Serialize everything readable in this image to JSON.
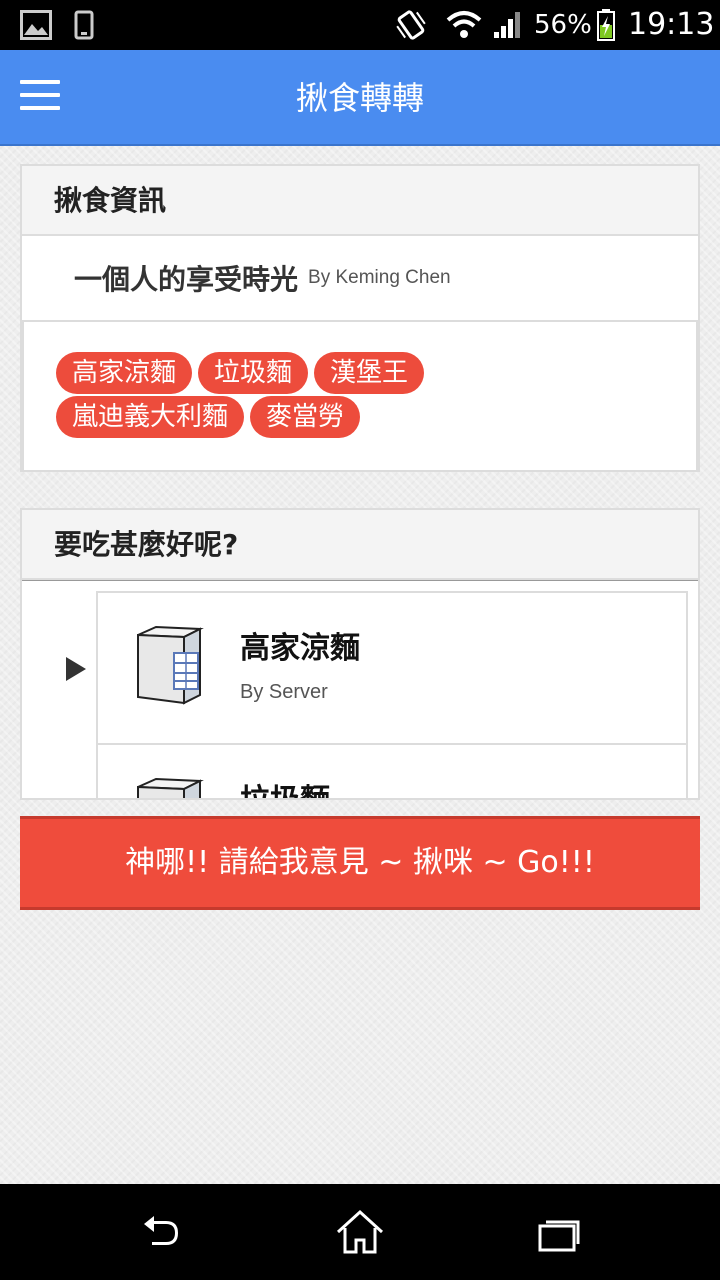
{
  "status_bar": {
    "battery_percent": "56%",
    "time": "19:13",
    "icons": [
      "image-icon",
      "phone-icon",
      "vibrate-icon",
      "wifi-icon",
      "signal-icon",
      "battery-charging-icon"
    ]
  },
  "app_bar": {
    "title": "揪食轉轉",
    "menu_icon": "hamburger-menu-icon"
  },
  "news_card": {
    "header": "揪食資訊",
    "item_title": "一個人的享受時光",
    "item_author": "By Keming Chen",
    "tags": [
      "高家涼麵",
      "垃圾麵",
      "漢堡王",
      "嵐迪義大利麵",
      "麥當勞"
    ]
  },
  "choice_card": {
    "header": "要吃甚麼好呢?",
    "items": [
      {
        "title": "高家涼麵",
        "subtitle": "By Server",
        "icon": "server-icon"
      },
      {
        "title": "垃圾麵",
        "subtitle": "",
        "icon": "server-icon"
      }
    ]
  },
  "go_button": {
    "label": "神哪!! 請給我意見 ~ 揪咪 ~ Go!!!"
  },
  "nav_bar": {
    "buttons": [
      "back-icon",
      "home-icon",
      "recents-icon"
    ]
  },
  "colors": {
    "app_bar": "#4a8cf0",
    "accent_red": "#ed4c3c",
    "status_bar": "#000000"
  }
}
